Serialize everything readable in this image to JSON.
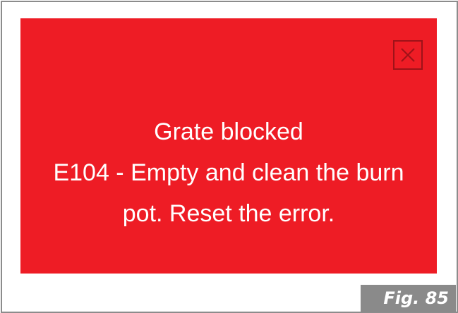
{
  "alert": {
    "title": "Grate blocked",
    "message_line1": "E104 - Empty and clean the burn",
    "message_line2": "pot. Reset the error.",
    "close_icon": "close-icon",
    "background_color": "#ee1c25",
    "text_color": "#ffffff"
  },
  "figure": {
    "label": "Fig. 85",
    "background_color": "#8a8a8a"
  }
}
